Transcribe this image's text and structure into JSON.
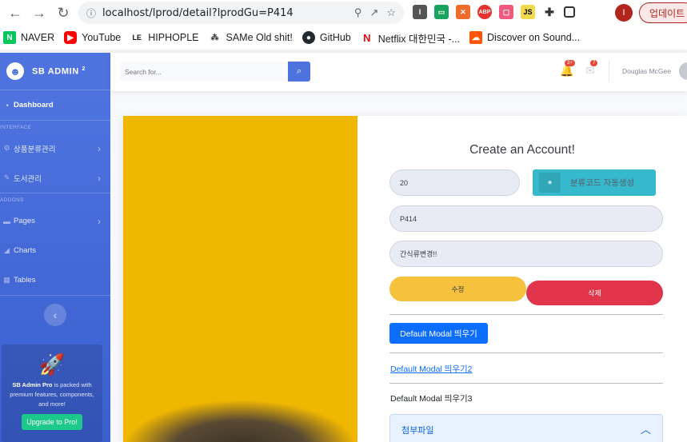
{
  "browser": {
    "url": "localhost/lprod/detail?lprodGu=P414",
    "update_label": "업데이트",
    "profile_initial": "I",
    "bookmarks": [
      {
        "label": "NAVER",
        "icon": "naver-icon",
        "color": "#03c75a"
      },
      {
        "label": "YouTube",
        "icon": "youtube-icon",
        "color": "#ff0000"
      },
      {
        "label": "HIPHOPLE",
        "icon": "hiphople-icon",
        "color": "#111111"
      },
      {
        "label": "SAMe Old shit!",
        "icon": "tree-icon",
        "color": "#333333"
      },
      {
        "label": "GitHub",
        "icon": "github-icon",
        "color": "#24292e"
      },
      {
        "label": "Netflix 대한민국 -...",
        "icon": "netflix-icon",
        "color": "#e50914"
      },
      {
        "label": "Discover on Sound...",
        "icon": "soundcloud-icon",
        "color": "#ff5500"
      }
    ]
  },
  "sidebar": {
    "brand": "SB ADMIN",
    "brand_sup": "2",
    "items": [
      {
        "label": "Dashboard"
      },
      {
        "heading": "INTERFACE"
      },
      {
        "label": "상품분류관리"
      },
      {
        "label": "도서관리"
      },
      {
        "heading": "ADDONS"
      },
      {
        "label": "Pages"
      },
      {
        "label": "Charts"
      },
      {
        "label": "Tables"
      }
    ],
    "promo": {
      "bold": "SB Admin Pro",
      "text": "is packed with premium features, components, and more!",
      "button": "Upgrade to Pro!"
    }
  },
  "topbar": {
    "search_placeholder": "Search for...",
    "alerts_badge": "3+",
    "messages_badge": "7",
    "user_name": "Douglas McGee"
  },
  "form": {
    "title": "Create an Account!",
    "lprod_id": "20",
    "generate_label": "분류코드 자동생성",
    "lprod_gu": "P414",
    "lprod_nm": "간식류변경!!",
    "edit_label": "수정",
    "delete_label": "삭제",
    "modal_button": "Default Modal 띄우기",
    "modal_link": "Default Modal 띄우기2",
    "modal_text": "Default Modal 띄우기3",
    "accordion_label": "첨부파일"
  },
  "colors": {
    "primary": "#4e73df",
    "warning": "#f6c23e",
    "danger": "#e0354b",
    "info": "#36b9cc",
    "image_bg": "#f0b700"
  }
}
